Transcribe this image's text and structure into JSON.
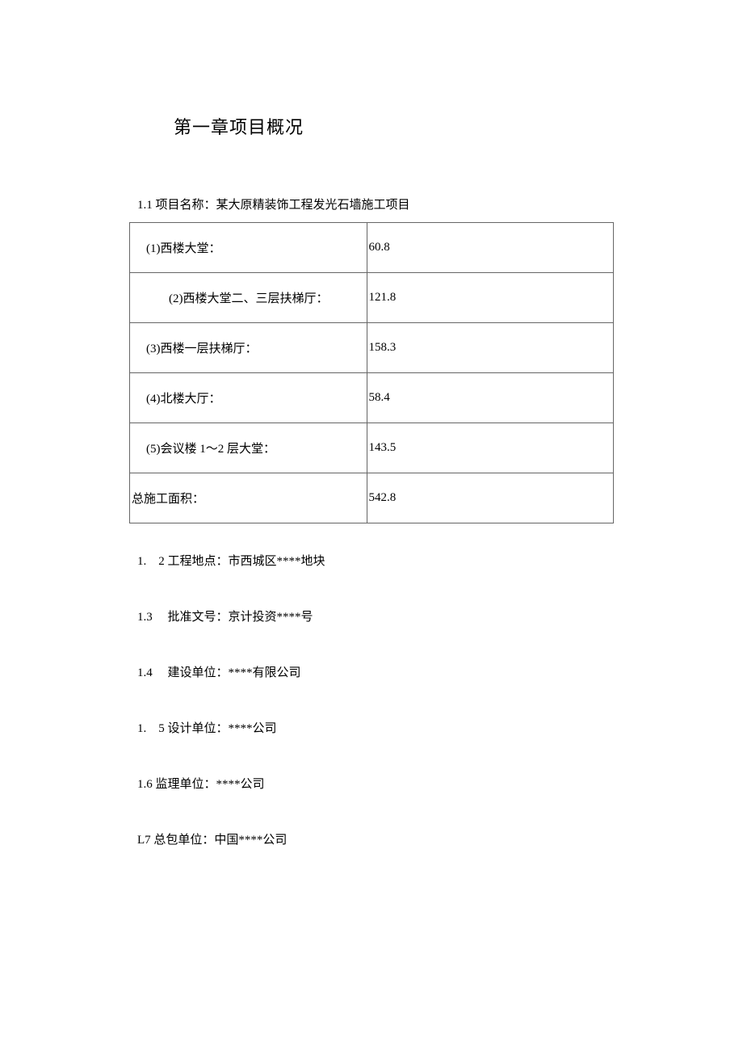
{
  "chapter_title": "第一章项目概况",
  "section_1_1": "1.1 项目名称：某大原精装饰工程发光石墙施工项目",
  "table": {
    "rows": [
      {
        "label": "(1)西楼大堂：",
        "value": "60.8",
        "indent": "normal"
      },
      {
        "label": "(2)西楼大堂二、三层扶梯厅：",
        "value": "121.8",
        "indent": "indent"
      },
      {
        "label": "(3)西楼一层扶梯厅：",
        "value": "158.3",
        "indent": "normal"
      },
      {
        "label": "(4)北楼大厅：",
        "value": "58.4",
        "indent": "normal"
      },
      {
        "label": "(5)会议楼 1～2 层大堂：",
        "value": "143.5",
        "indent": "normal"
      },
      {
        "label": "总施工面积：",
        "value": "542.8",
        "indent": "noindent"
      }
    ]
  },
  "info_lines": [
    "1.　2 工程地点：市西城区****地块",
    "1.3　 批准文号：京计投资****号",
    "1.4　 建设单位：****有限公司",
    "1.　5 设计单位：****公司",
    "1.6 监理单位：****公司",
    "L7 总包单位：中国****公司"
  ]
}
